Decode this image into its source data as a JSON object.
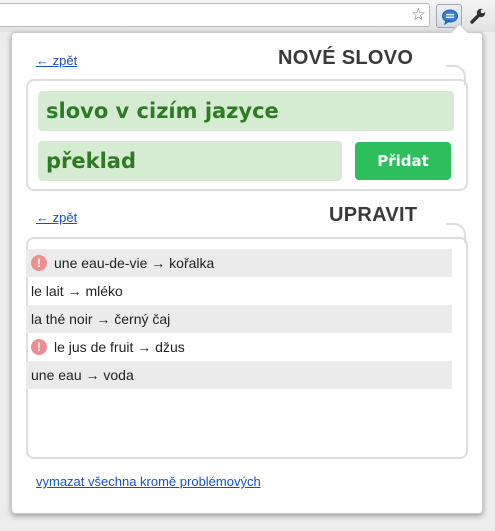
{
  "toolbar": {
    "star_icon": "star-outline",
    "extension_icon": "speech-bubble",
    "menu_icon": "wrench"
  },
  "popup": {
    "new_word": {
      "back_link": "← zpět",
      "heading": "NOVÉ SLOVO",
      "foreign_placeholder": "slovo v cizím jazyce",
      "translation_placeholder": "překlad",
      "add_button": "Přidat"
    },
    "edit": {
      "back_link": "← zpět",
      "heading": "UPRAVIT",
      "items": [
        {
          "text": "une eau-de-vie → kořalka",
          "problem": true
        },
        {
          "text": "le lait → mléko",
          "problem": false
        },
        {
          "text": "la thé noir → černý čaj",
          "problem": false
        },
        {
          "text": "le jus de fruit → džus",
          "problem": true
        },
        {
          "text": "une eau → voda",
          "problem": false
        }
      ],
      "warning_glyph": "!",
      "clear_link": "vymazat všechna kromě problémových"
    }
  },
  "colors": {
    "field_bg": "#d6ecd2",
    "field_text": "#2f7a24",
    "add_button_bg": "#2cbf5c",
    "link": "#1a4fc4",
    "warning": "#ee8f8f"
  }
}
